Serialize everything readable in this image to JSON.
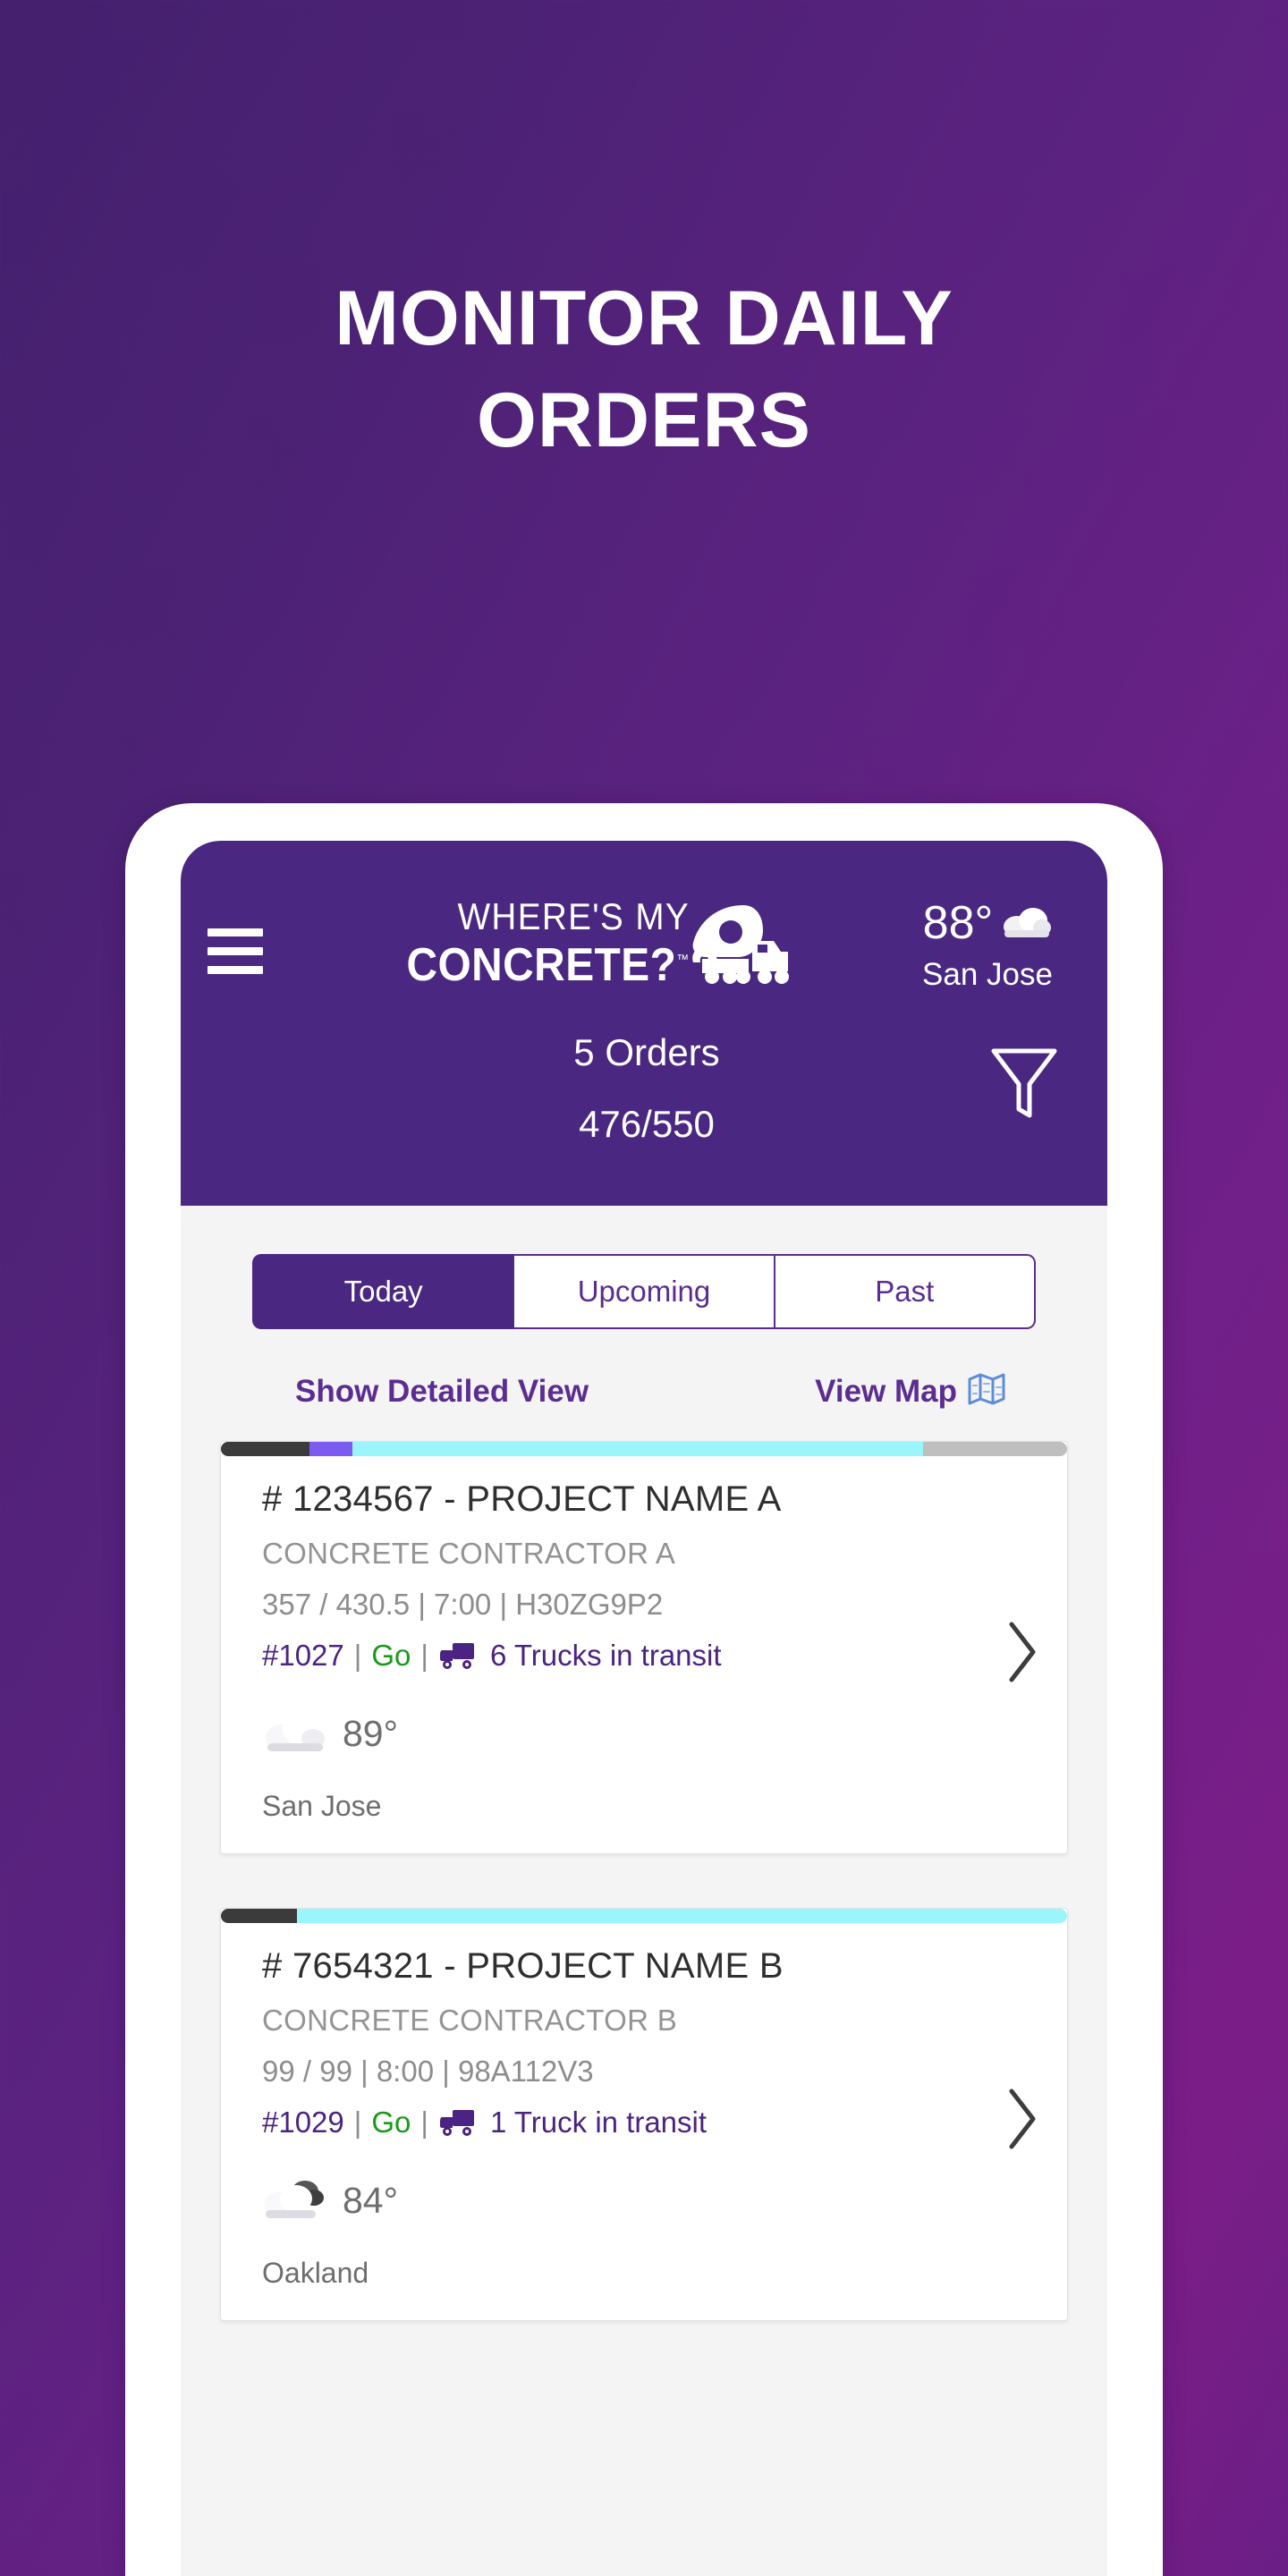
{
  "hero": {
    "line1": "MONITOR DAILY",
    "line2": "ORDERS"
  },
  "app": {
    "header": {
      "menu_icon": "hamburger-menu-icon",
      "brand_line1": "WHERE'S MY",
      "brand_line2": "CONCRETE?",
      "brand_tm": "™",
      "brand_truck_icon": "concrete-mixer-truck-icon",
      "weather": {
        "temperature": "88°",
        "icon": "cloud-icon",
        "city": "San Jose"
      },
      "filter_icon": "filter-funnel-icon",
      "orders_count": "5 Orders",
      "volume": "476/550",
      "background_color": "#4a2882"
    },
    "tabs": [
      {
        "label": "Today",
        "active": true
      },
      {
        "label": "Upcoming",
        "active": false
      },
      {
        "label": "Past",
        "active": false
      }
    ],
    "links": {
      "detailed_view": "Show Detailed View",
      "view_map": "View Map",
      "map_icon": "folded-map-icon"
    },
    "orders": [
      {
        "progress": [
          {
            "color": "#3b3b3b",
            "percent": 10.5
          },
          {
            "color": "#7c5cf0",
            "percent": 5.0
          },
          {
            "color": "#9bf6fb",
            "percent": 67.5
          },
          {
            "color": "#bfbfbf",
            "percent": 17.0
          }
        ],
        "title": "# 1234567 - PROJECT NAME A",
        "contractor": "CONCRETE CONTRACTOR A",
        "meta": "357 / 430.5 | 7:00 | H30ZG9P2",
        "ticket": "#1027",
        "go_label": "Go",
        "truck_icon": "delivery-truck-icon",
        "transit": "6 Trucks in transit",
        "weather_icon": "cloud-icon",
        "temperature": "89°",
        "city": "San Jose",
        "chevron_icon": "chevron-right-icon"
      },
      {
        "progress": [
          {
            "color": "#3b3b3b",
            "percent": 9.0
          },
          {
            "color": "#9bf6fb",
            "percent": 91.0
          }
        ],
        "title": "# 7654321 - PROJECT NAME B",
        "contractor": "CONCRETE CONTRACTOR B",
        "meta": "99 / 99 | 8:00 | 98A112V3",
        "ticket": "#1029",
        "go_label": "Go",
        "truck_icon": "delivery-truck-icon",
        "transit": "1 Truck in transit",
        "weather_icon": "partly-cloudy-icon",
        "temperature": "84°",
        "city": "Oakland",
        "chevron_icon": "chevron-right-icon"
      }
    ]
  },
  "colors": {
    "brand_purple": "#4a2882",
    "link_purple": "#5b2d91",
    "go_green": "#1a9a1a",
    "map_blue": "#5b8dd9",
    "cyan": "#9bf6fb"
  }
}
